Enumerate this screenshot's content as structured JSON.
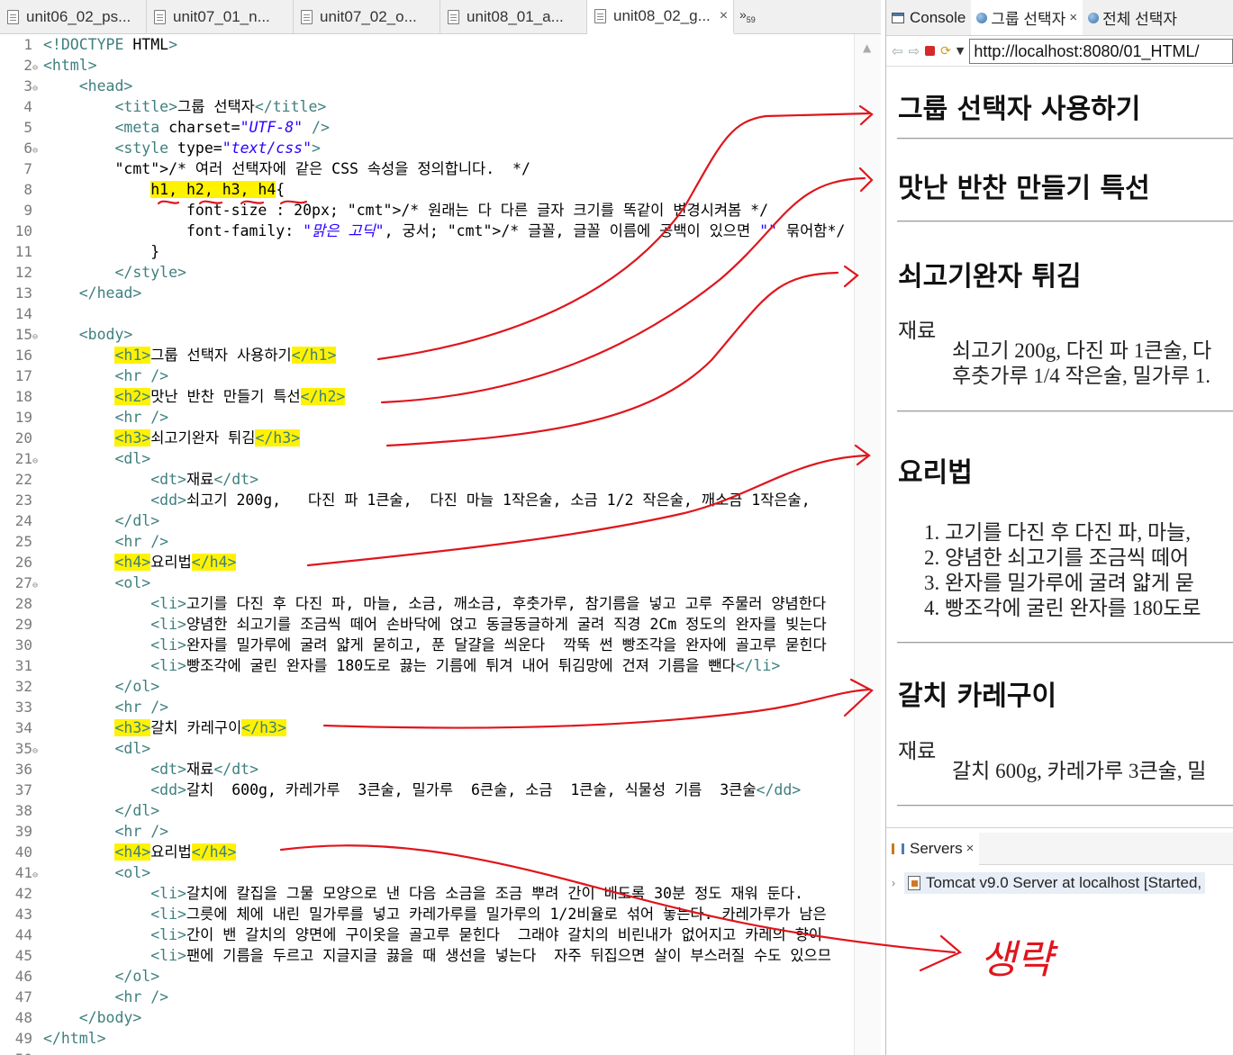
{
  "editor": {
    "tabs": [
      {
        "label": "unit06_02_ps..."
      },
      {
        "label": "unit07_01_n..."
      },
      {
        "label": "unit07_02_o..."
      },
      {
        "label": "unit08_01_a..."
      },
      {
        "label": "unit08_02_g...",
        "active": true
      }
    ],
    "overflow_label": "»",
    "overflow_count": "59",
    "lines": [
      {
        "n": "1",
        "t": "<!DOCTYPE HTML>"
      },
      {
        "n": "2",
        "t": "<html>",
        "fold": true
      },
      {
        "n": "3",
        "t": "    <head>",
        "fold": true
      },
      {
        "n": "4",
        "t": "        <title>그룹 선택자</title>"
      },
      {
        "n": "5",
        "t": "        <meta charset=\"UTF-8\" />"
      },
      {
        "n": "6",
        "t": "        <style type=\"text/css\">",
        "fold": true
      },
      {
        "n": "7",
        "t": "        /* 여러 선택자에 같은 CSS 속성을 정의합니다.  */"
      },
      {
        "n": "8",
        "t": "            h1, h2, h3, h4{"
      },
      {
        "n": "9",
        "t": "                font-size : 20px; /* 원래는 다 다른 글자 크기를 똑같이 변경시켜봄 */"
      },
      {
        "n": "10",
        "t": "                font-family: \"맑은 고딕\", 궁서; /* 글꼴, 글꼴 이름에 공백이 있으면 \"\" 묶어함*/"
      },
      {
        "n": "11",
        "t": "            }"
      },
      {
        "n": "12",
        "t": "        </style>"
      },
      {
        "n": "13",
        "t": "    </head>"
      },
      {
        "n": "14",
        "t": ""
      },
      {
        "n": "15",
        "t": "    <body>",
        "fold": true
      },
      {
        "n": "16",
        "t": "        <h1>그룹 선택자 사용하기</h1>"
      },
      {
        "n": "17",
        "t": "        <hr />"
      },
      {
        "n": "18",
        "t": "        <h2>맛난 반찬 만들기 특선</h2>"
      },
      {
        "n": "19",
        "t": "        <hr />"
      },
      {
        "n": "20",
        "t": "        <h3>쇠고기완자 튀김</h3>"
      },
      {
        "n": "21",
        "t": "        <dl>",
        "fold": true
      },
      {
        "n": "22",
        "t": "            <dt>재료</dt>"
      },
      {
        "n": "23",
        "t": "            <dd>쇠고기 200g,   다진 파 1큰술,  다진 마늘 1작은술, 소금 1/2 작은술, 깨소금 1작은술,"
      },
      {
        "n": "24",
        "t": "        </dl>"
      },
      {
        "n": "25",
        "t": "        <hr />"
      },
      {
        "n": "26",
        "t": "        <h4>요리법</h4>"
      },
      {
        "n": "27",
        "t": "        <ol>",
        "fold": true
      },
      {
        "n": "28",
        "t": "            <li>고기를 다진 후 다진 파, 마늘, 소금, 깨소금, 후춧가루, 참기름을 넣고 고루 주물러 양념한다"
      },
      {
        "n": "29",
        "t": "            <li>양념한 쇠고기를 조금씩 떼어 손바닥에 얹고 동글동글하게 굴려 직경 2Cm 정도의 완자를 빚는다"
      },
      {
        "n": "30",
        "t": "            <li>완자를 밀가루에 굴려 얇게 묻히고, 푼 달걀을 씌운다  깍뚝 썬 빵조각을 완자에 골고루 묻힌다"
      },
      {
        "n": "31",
        "t": "            <li>빵조각에 굴린 완자를 180도로 끓는 기름에 튀겨 내어 튀김망에 건져 기름을 뺀다</li>"
      },
      {
        "n": "32",
        "t": "        </ol>"
      },
      {
        "n": "33",
        "t": "        <hr />"
      },
      {
        "n": "34",
        "t": "        <h3>갈치 카레구이</h3>"
      },
      {
        "n": "35",
        "t": "        <dl>",
        "fold": true
      },
      {
        "n": "36",
        "t": "            <dt>재료</dt>"
      },
      {
        "n": "37",
        "t": "            <dd>갈치  600g, 카레가루  3큰술, 밀가루  6큰술, 소금  1큰술, 식물성 기름  3큰술</dd>"
      },
      {
        "n": "38",
        "t": "        </dl>"
      },
      {
        "n": "39",
        "t": "        <hr />"
      },
      {
        "n": "40",
        "t": "        <h4>요리법</h4>"
      },
      {
        "n": "41",
        "t": "        <ol>",
        "fold": true
      },
      {
        "n": "42",
        "t": "            <li>갈치에 칼집을 그물 모양으로 낸 다음 소금을 조금 뿌려 간이 배도록 30분 정도 재워 둔다."
      },
      {
        "n": "43",
        "t": "            <li>그릇에 체에 내린 밀가루를 넣고 카레가루를 밀가루의 1/2비율로 섞어 놓는다. 카레가루가 남은"
      },
      {
        "n": "44",
        "t": "            <li>간이 밴 갈치의 양면에 구이옷을 골고루 묻힌다  그래야 갈치의 비린내가 없어지고 카레의 향이"
      },
      {
        "n": "45",
        "t": "            <li>팬에 기름을 두르고 지글지글 끓을 때 생선을 넣는다  자주 뒤집으면 살이 부스러질 수도 있으므"
      },
      {
        "n": "46",
        "t": "        </ol>"
      },
      {
        "n": "47",
        "t": "        <hr />"
      },
      {
        "n": "48",
        "t": "    </body>"
      },
      {
        "n": "49",
        "t": "</html>"
      },
      {
        "n": "50",
        "t": ""
      }
    ]
  },
  "views": {
    "tabs": [
      {
        "label": "Console",
        "icon": "console-icon"
      },
      {
        "label": "그룹 선택자",
        "icon": "browser-globe-icon",
        "active": true
      },
      {
        "label": "전체 선택자",
        "icon": "browser-globe-icon"
      }
    ],
    "close_glyph": "×"
  },
  "browser": {
    "url": "http://localhost:8080/01_HTML/"
  },
  "rendered_page": {
    "h1": "그룹 선택자 사용하기",
    "h2": "맛난 반찬 만들기 특선",
    "h3a": "쇠고기완자 튀김",
    "dt_a": "재료",
    "dd_a_line1": "쇠고기 200g, 다진 파 1큰술, 다",
    "dd_a_line2": "후춧가루 1/4 작은술, 밀가루 1.",
    "h4a": "요리법",
    "list_a": [
      "1. 고기를 다진 후 다진 파, 마늘,",
      "2. 양념한 쇠고기를 조금씩 떼어",
      "3. 완자를 밀가루에 굴려 얇게 묻",
      "4. 빵조각에 굴린 완자를 180도로"
    ],
    "h3b": "갈치 카레구이",
    "dt_b": "재료",
    "dd_b_line1": "갈치 600g, 카레가루 3큰술, 밀"
  },
  "servers": {
    "tab_label": "Servers",
    "entry": "Tomcat v9.0 Server at localhost  [Started,"
  },
  "annotation": {
    "omitted_label": "생략",
    "color": "#e0151d",
    "highlight_color": "#fff200"
  }
}
